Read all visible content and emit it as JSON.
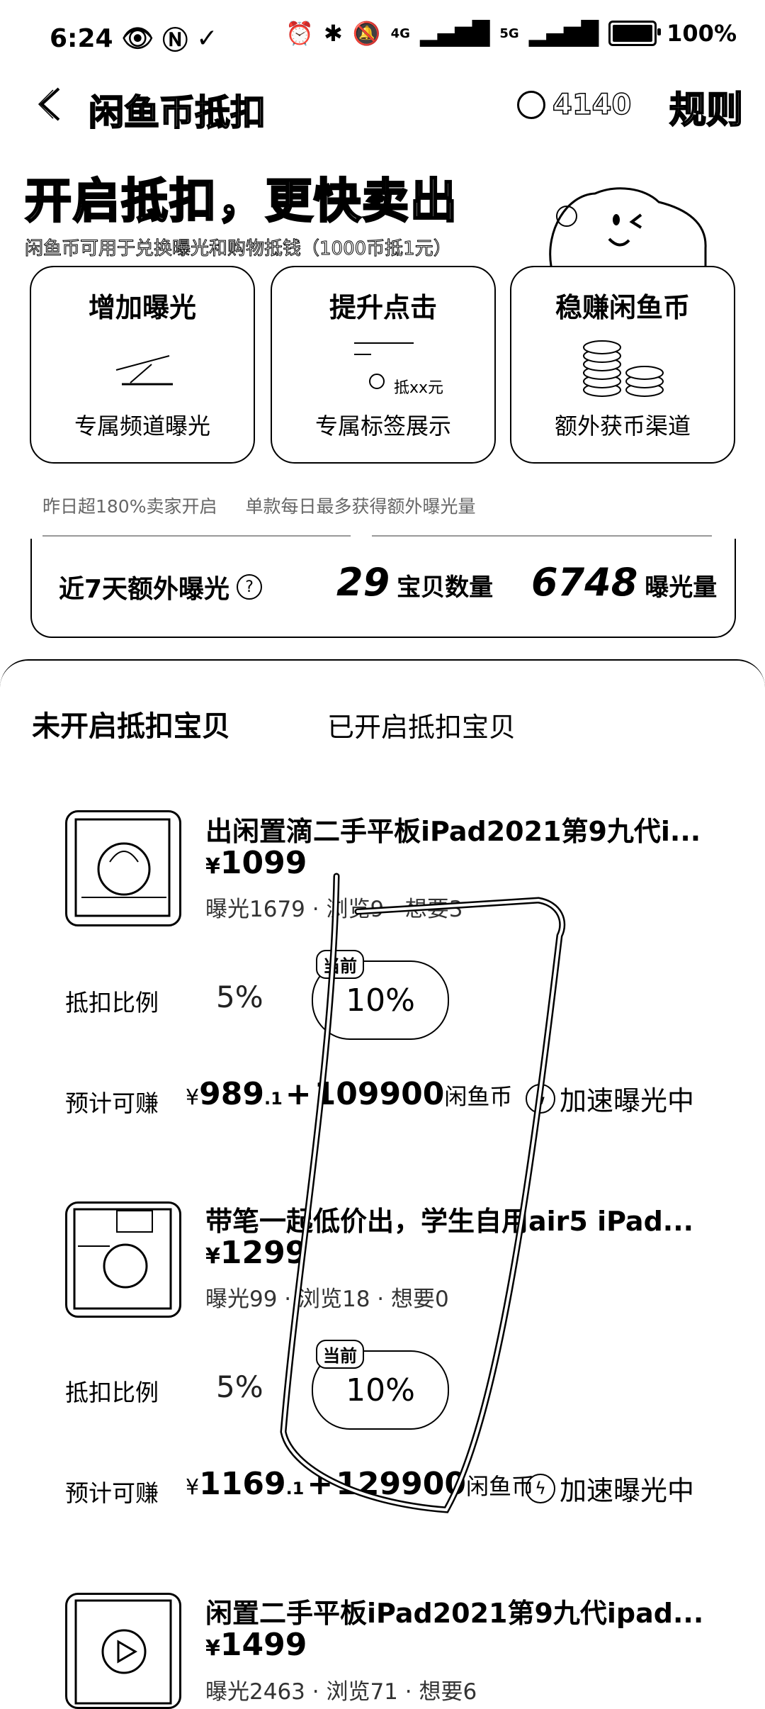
{
  "status_bar": {
    "time": "6:24",
    "battery": "100%",
    "signal_4g": "4G",
    "signal_5g": "5G"
  },
  "header": {
    "title": "闲鱼币抵扣",
    "coin_balance": "4140",
    "rules": "规则"
  },
  "banner": {
    "headline": "开启抵扣，更快卖出",
    "subtitle": "闲鱼币可用于兑换曝光和购物抵钱（1000币抵1元）"
  },
  "features": [
    {
      "title": "增加曝光",
      "desc": "专属频道曝光"
    },
    {
      "title": "提升点击",
      "desc": "专属标签展示",
      "art_text": "抵xx元"
    },
    {
      "title": "稳赚闲鱼币",
      "desc": "额外获币渠道"
    }
  ],
  "tips": [
    "昨日超180%卖家开启",
    "单款每日最多获得额外曝光量"
  ],
  "stats": {
    "label": "近7天额外曝光",
    "help_icon": "?",
    "count": "29",
    "count_unit": "宝贝数量",
    "exposure": "6748",
    "exposure_unit": "曝光量"
  },
  "tabs": {
    "active": "未开启抵扣宝贝",
    "inactive": "已开启抵扣宝贝"
  },
  "items": [
    {
      "title": "出闲置滴二手平板iPad2021第9九代i...",
      "currency": "¥",
      "price": "1099",
      "meta": "曝光1679 · 浏览9 · 想要3",
      "ratio_label": "抵扣比例",
      "ratio_low": "5%",
      "ratio_current": "10%",
      "current_tag": "当前",
      "earn_label": "预计可赚",
      "earn_int": "989",
      "earn_dec": ".1",
      "earn_plus": "+",
      "earn_coins": "109900",
      "coin_unit": "闲鱼币",
      "speed_label": "加速曝光中"
    },
    {
      "title": "带笔一起低价出，学生自用air5 iPad...",
      "currency": "¥",
      "price": "1299",
      "meta": "曝光99 · 浏览18 · 想要0",
      "ratio_label": "抵扣比例",
      "ratio_low": "5%",
      "ratio_current": "10%",
      "current_tag": "当前",
      "earn_label": "预计可赚",
      "earn_int": "1169",
      "earn_dec": ".1",
      "earn_plus": "+",
      "earn_coins": "129900",
      "coin_unit": "闲鱼币",
      "speed_label": "加速曝光中"
    },
    {
      "title": "闲置二手平板iPad2021第9九代ipad...",
      "currency": "¥",
      "price": "1499",
      "meta": "曝光2463 · 浏览71 · 想要6"
    }
  ]
}
